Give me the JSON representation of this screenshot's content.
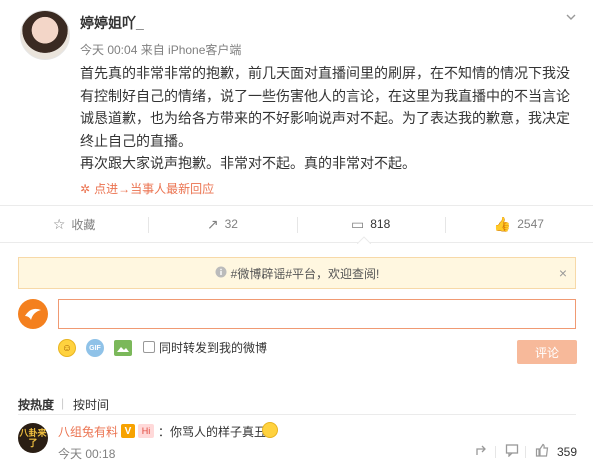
{
  "post": {
    "username": "婷婷姐吖_",
    "meta": "今天 00:04 来自 iPhone客户端",
    "paragraphs": [
      "首先真的非常非常的抱歉，前几天面对直播间里的刷屏，在不知情的情况下我没有控制好自己的情绪，说了一些伤害他人的言论，在这里为我直播中的不当言论诚恳道歉，也为给各方带来的不好影响说声对不起。为了表达我的歉意，我决定终止自己的直播。",
      "再次跟大家说声抱歉。非常对不起。真的非常对不起。"
    ],
    "unfold_icon": "✲",
    "unfold_link": "点进→当事人最新回应"
  },
  "actions": [
    {
      "icon": "☆",
      "label": "收藏"
    },
    {
      "icon": "↗",
      "label": "32"
    },
    {
      "icon": "▭",
      "label": "818"
    },
    {
      "icon": "👍",
      "label": "2547"
    }
  ],
  "notice": {
    "text": "#微博辟谣#平台，欢迎查阅!",
    "icon": "info-icon",
    "close": "×"
  },
  "compose": {
    "input_value": "",
    "gif_label": "GIF",
    "repost_label": "同时转发到我的微博",
    "submit_label": "评论"
  },
  "sort": {
    "tab1": "按热度",
    "sep": "|",
    "tab2": "按时间"
  },
  "comment": {
    "avatar_text": "八卦来了",
    "name": "八组兔有料",
    "badge": "V",
    "badge2": "Hi",
    "text": "：你骂人的样子真丑",
    "time": "今天 00:18",
    "like_count": "359"
  },
  "colors": {
    "accent": "#eb7350",
    "submit_disabled": "#f7b99a",
    "notice_bg": "#fff7e0"
  }
}
